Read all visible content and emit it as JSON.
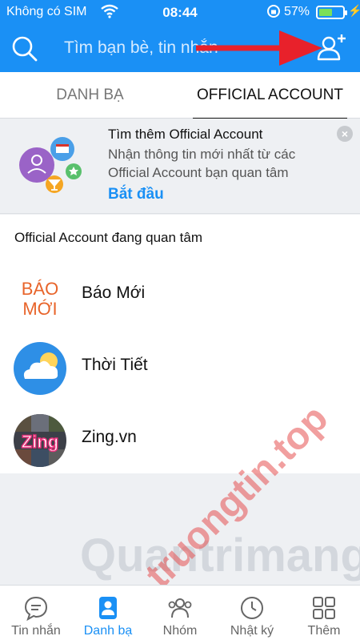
{
  "status_bar": {
    "carrier": "Không có SIM",
    "time": "08:44",
    "battery_percent": "57%",
    "battery_level": 0.57
  },
  "header": {
    "search_placeholder": "Tìm bạn bè, tin nhắn",
    "search_icon": "search-icon",
    "add_friend_icon": "add-friend-icon",
    "bg_color": "#1a90f5"
  },
  "tabs": [
    {
      "label": "DANH BẠ",
      "active": false
    },
    {
      "label": "OFFICIAL ACCOUNT",
      "active": true
    }
  ],
  "promo": {
    "title": "Tìm thêm Official Account",
    "description": "Nhận thông tin mới nhất từ các Official Account bạn quan tâm",
    "cta": "Bắt đầu",
    "close_icon": "close-icon"
  },
  "section": {
    "title": "Official Account đang quan tâm",
    "items": [
      {
        "name": "Báo Mới",
        "logo_text": "BÁO MỚI"
      },
      {
        "name": "Thời Tiết",
        "icon": "weather-icon"
      },
      {
        "name": "Zing.vn",
        "logo_text": "Zing"
      }
    ]
  },
  "watermark": {
    "text": "Quantrimang",
    "text2": "truongtin.top"
  },
  "bottom_nav": [
    {
      "label": "Tin nhắn",
      "icon": "chat-icon",
      "active": false
    },
    {
      "label": "Danh bạ",
      "icon": "contacts-icon",
      "active": true
    },
    {
      "label": "Nhóm",
      "icon": "group-icon",
      "active": false
    },
    {
      "label": "Nhật ký",
      "icon": "clock-icon",
      "active": false
    },
    {
      "label": "Thêm",
      "icon": "grid-icon",
      "active": false
    }
  ],
  "accent_color": "#1a90f5"
}
